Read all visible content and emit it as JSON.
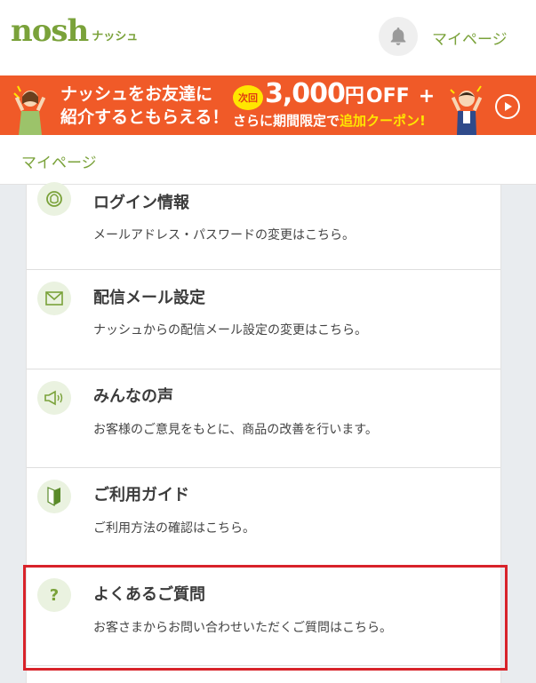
{
  "header": {
    "logo_main": "nosh",
    "logo_sub": "ナッシュ",
    "mypage_link": "マイページ"
  },
  "banner": {
    "line1": "ナッシュをお友達に",
    "line2": "紹介するともらえる！",
    "badge": "次回",
    "amount": "3,000",
    "yen": "円",
    "off": "OFF",
    "plus": "+",
    "line3_a": "さらに期間限定で",
    "line3_b": "追加クーポン!"
  },
  "page": {
    "title": "マイページ"
  },
  "menu": {
    "items": [
      {
        "icon": "login-icon",
        "title": "ログイン情報",
        "desc": "メールアドレス・パスワードの変更はこちら。"
      },
      {
        "icon": "mail-icon",
        "title": "配信メール設定",
        "desc": "ナッシュからの配信メール設定の変更はこちら。"
      },
      {
        "icon": "megaphone-icon",
        "title": "みんなの声",
        "desc": "お客様のご意見をもとに、商品の改善を行います。"
      },
      {
        "icon": "beginner-mark-icon",
        "title": "ご利用ガイド",
        "desc": "ご利用方法の確認はこちら。"
      },
      {
        "icon": "question-icon",
        "title": "よくあるご質問",
        "desc": "お客さまからお問い合わせいただくご質問はこちら。",
        "icon_text": "?"
      }
    ]
  },
  "colors": {
    "brand_green": "#7aa23a",
    "banner_orange": "#f05a28",
    "highlight_red": "#d8232a"
  }
}
